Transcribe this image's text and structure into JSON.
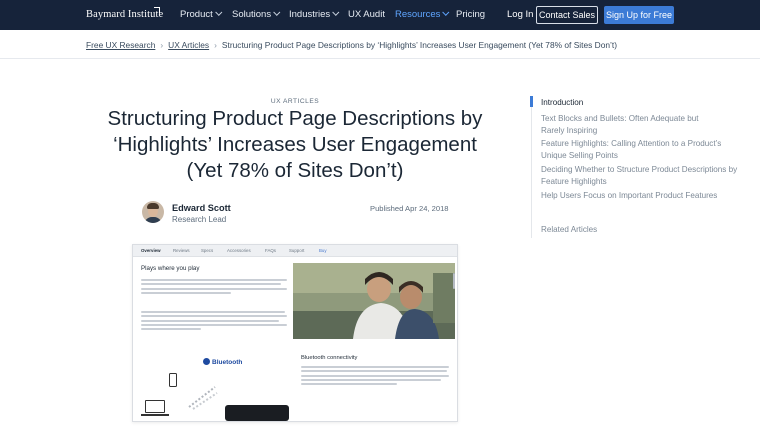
{
  "nav": {
    "logo": "Baymard Institute",
    "items": [
      {
        "label": "Product",
        "dropdown": true
      },
      {
        "label": "Solutions",
        "dropdown": true
      },
      {
        "label": "Industries",
        "dropdown": true
      },
      {
        "label": "UX Audit",
        "dropdown": false
      },
      {
        "label": "Resources",
        "dropdown": true,
        "active": true
      },
      {
        "label": "Pricing",
        "dropdown": false
      }
    ],
    "login": "Log In",
    "contact": "Contact Sales",
    "signup": "Sign Up for Free"
  },
  "breadcrumb": {
    "items": [
      "Free UX Research",
      "UX Articles"
    ],
    "current": "Structuring Product Page Descriptions by ‘Highlights’ Increases User Engagement (Yet 78% of Sites Don’t)"
  },
  "article": {
    "kicker": "UX ARTICLES",
    "title": "Structuring Product Page Descriptions by ‘Highlights’ Increases User Engagement (Yet 78% of Sites Don’t)",
    "author": "Edward Scott",
    "role": "Research Lead",
    "published": "Published Apr 24, 2018"
  },
  "figure": {
    "tabs": [
      "Overview",
      "Reviews",
      "Specs",
      "Accessories",
      "FAQs",
      "Support",
      "Buy"
    ],
    "heading1": "Plays where you play",
    "heading2": "Bluetooth connectivity",
    "bluetooth": "Bluetooth"
  },
  "toc": {
    "items": [
      "Introduction",
      "Text Blocks and Bullets: Often Adequate but Rarely Inspiring",
      "Feature Highlights: Calling Attention to a Product’s Unique Selling Points",
      "Deciding Whether to Structure Product Descriptions by Feature Highlights",
      "Help Users Focus on Important Product Features",
      "Related Articles"
    ]
  },
  "colors": {
    "nav_bg": "#16233a",
    "accent": "#3c7bd6",
    "active_nav": "#5fa5ff"
  }
}
